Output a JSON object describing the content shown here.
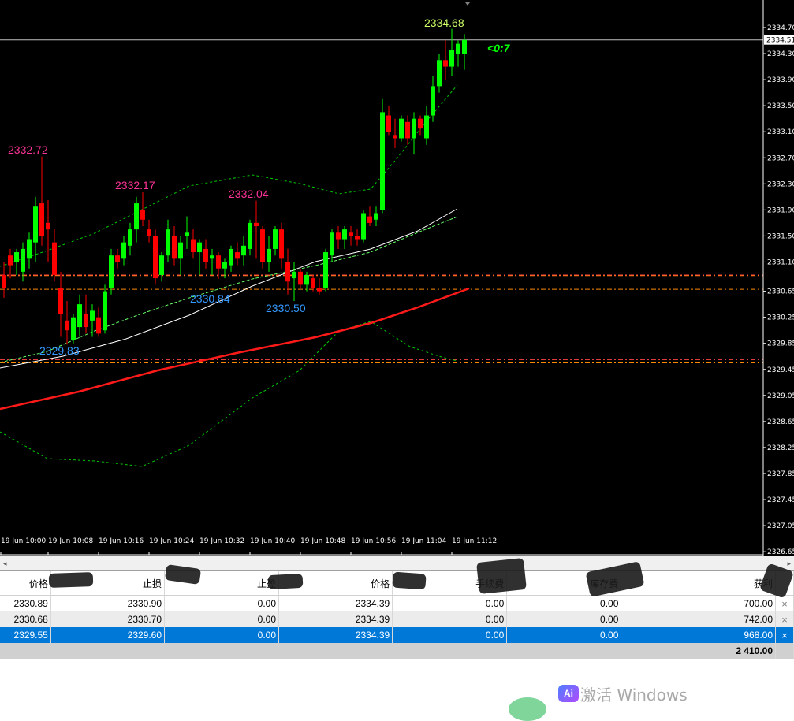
{
  "chart": {
    "price_axis": [
      "2334.70",
      "2334.30",
      "2333.90",
      "2333.50",
      "2333.10",
      "2332.70",
      "2332.30",
      "2331.90",
      "2331.50",
      "2331.10",
      "2330.65",
      "2330.25",
      "2329.85",
      "2329.45",
      "2329.05",
      "2328.65",
      "2328.25",
      "2327.85",
      "2327.45",
      "2327.05",
      "2326.65"
    ],
    "current_price": "2334.51",
    "countdown": "<0:7",
    "time_axis": [
      "19 Jun 10:00",
      "19 Jun 10:08",
      "19 Jun 10:16",
      "19 Jun 10:24",
      "19 Jun 10:32",
      "19 Jun 10:40",
      "19 Jun 10:48",
      "19 Jun 10:56",
      "19 Jun 11:04",
      "19 Jun 11:12"
    ],
    "high_labels": [
      "2332.72",
      "2332.17",
      "2332.04",
      "2334.68"
    ],
    "low_labels": [
      "2329.83",
      "2330.84",
      "2330.50"
    ],
    "colors": {
      "bull": "#00ff00",
      "bear": "#ff0000",
      "high_label": "#ff3399",
      "low_label": "#3399ff",
      "max_label": "#ccff66",
      "countdown": "#00ff00"
    }
  },
  "terminal": {
    "headers": [
      "价格",
      "止损",
      "止盈",
      "价格",
      "手续费",
      "库存费",
      "获利"
    ],
    "rows": [
      [
        "2330.89",
        "2330.90",
        "0.00",
        "2334.39",
        "0.00",
        "0.00",
        "700.00"
      ],
      [
        "2330.68",
        "2330.70",
        "0.00",
        "2334.39",
        "0.00",
        "0.00",
        "742.00"
      ],
      [
        "2329.55",
        "2329.60",
        "0.00",
        "2334.39",
        "0.00",
        "0.00",
        "968.00"
      ]
    ],
    "close_icon": "×",
    "total_profit": "2 410.00"
  },
  "overlay": {
    "watermark": "激活 Windows",
    "ai_badge": "Ai"
  }
}
